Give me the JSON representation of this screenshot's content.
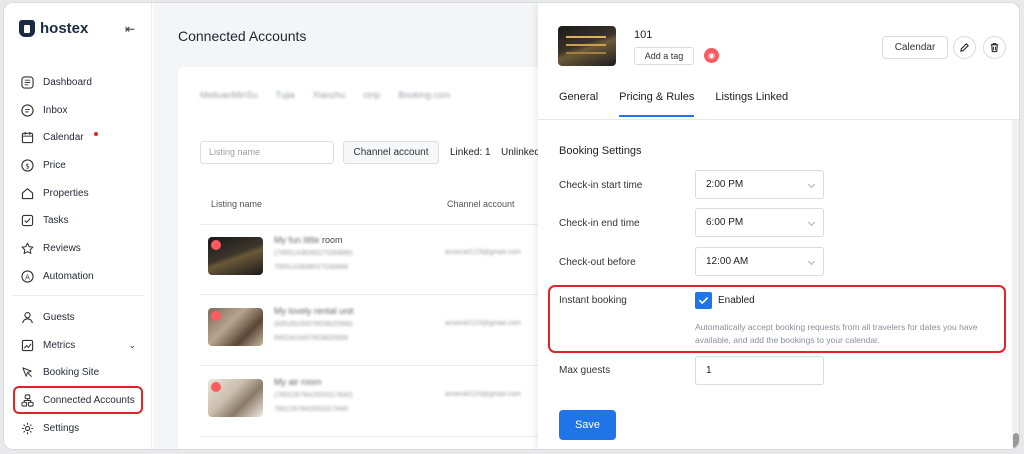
{
  "app": {
    "name": "hostex"
  },
  "sidebar": {
    "items": [
      {
        "label": "Dashboard",
        "icon": "dashboard-icon"
      },
      {
        "label": "Inbox",
        "icon": "inbox-icon"
      },
      {
        "label": "Calendar",
        "icon": "calendar-icon",
        "badge": true
      },
      {
        "label": "Price",
        "icon": "price-icon"
      },
      {
        "label": "Properties",
        "icon": "home-icon"
      },
      {
        "label": "Tasks",
        "icon": "tasks-icon"
      },
      {
        "label": "Reviews",
        "icon": "star-icon"
      },
      {
        "label": "Automation",
        "icon": "automation-icon"
      }
    ],
    "items2": [
      {
        "label": "Guests",
        "icon": "user-icon"
      },
      {
        "label": "Metrics",
        "icon": "metrics-icon"
      },
      {
        "label": "Booking Site",
        "icon": "booking-site-icon"
      },
      {
        "label": "Connected Accounts",
        "icon": "connected-accounts-icon",
        "active": true
      },
      {
        "label": "Settings",
        "icon": "gear-icon"
      }
    ]
  },
  "main": {
    "title": "Connected Accounts",
    "channel_tabs": [
      "MeituanMinSu",
      "Tujia",
      "Xiaozhu",
      "ctrip",
      "Booking.com"
    ],
    "search_placeholder": "Listing name",
    "channel_button": "Channel account",
    "linked_text": "Linked: 1",
    "unlinked_text": "Unlinked",
    "columns": [
      "Listing name",
      "Channel account"
    ],
    "rows": [
      {
        "name_prefix": "My fun little",
        "name_suffix": "room",
        "id1": "(7955143839027030686)",
        "id2": "7955143839027030686",
        "email": "ansera0123@gmail.com"
      },
      {
        "name_prefix": "My lovely rental unit",
        "name_suffix": "",
        "id1": "(6952810007803820568)",
        "id2": "6952810007803820568",
        "email": "ansera0123@gmail.com"
      },
      {
        "name_prefix": "My air room",
        "name_suffix": "",
        "id1": "(7802267842553317840)",
        "id2": "7802267842553317840",
        "email": "ansera0123@gmail.com"
      }
    ]
  },
  "drawer": {
    "listing_id": "101",
    "add_tag": "Add a tag",
    "calendar_button": "Calendar",
    "tabs": [
      "General",
      "Pricing & Rules",
      "Listings Linked"
    ],
    "active_tab": "Pricing & Rules",
    "section_title": "Booking Settings",
    "fields": {
      "checkin_start_label": "Check-in start time",
      "checkin_start_value": "2:00 PM",
      "checkin_end_label": "Check-in end time",
      "checkin_end_value": "6:00 PM",
      "checkout_label": "Check-out before",
      "checkout_value": "12:00 AM",
      "instant_label": "Instant booking",
      "instant_value": "Enabled",
      "instant_hint": "Automatically accept booking requests from all travelers for dates you have available, and add the bookings to your calendar.",
      "max_guests_label": "Max guests",
      "max_guests_value": "1"
    },
    "save_button": "Save"
  },
  "colors": {
    "accent": "#1f74e8",
    "highlight": "#e0242a",
    "airbnb": "#ff5a5f"
  }
}
